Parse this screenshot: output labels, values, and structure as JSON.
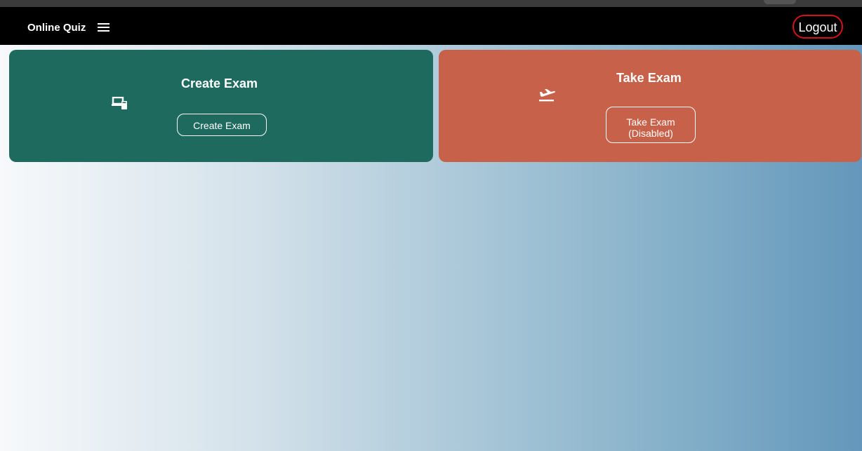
{
  "header": {
    "brand": "Online Quiz",
    "menu_icon": "hamburger-menu-icon",
    "logout_label": "Logout"
  },
  "cards": {
    "create": {
      "title": "Create Exam",
      "button_label": "Create Exam",
      "icon": "devices-icon",
      "color": "#1e6a5f"
    },
    "take": {
      "title": "Take Exam",
      "button_line1": "Take Exam",
      "button_line2": "(Disabled)",
      "icon": "plane-departure-icon",
      "color": "#c86149"
    }
  },
  "colors": {
    "navbar": "#000000",
    "logout_border": "#d41414",
    "background_start": "#f7f9fb",
    "background_end": "#6497bb"
  }
}
